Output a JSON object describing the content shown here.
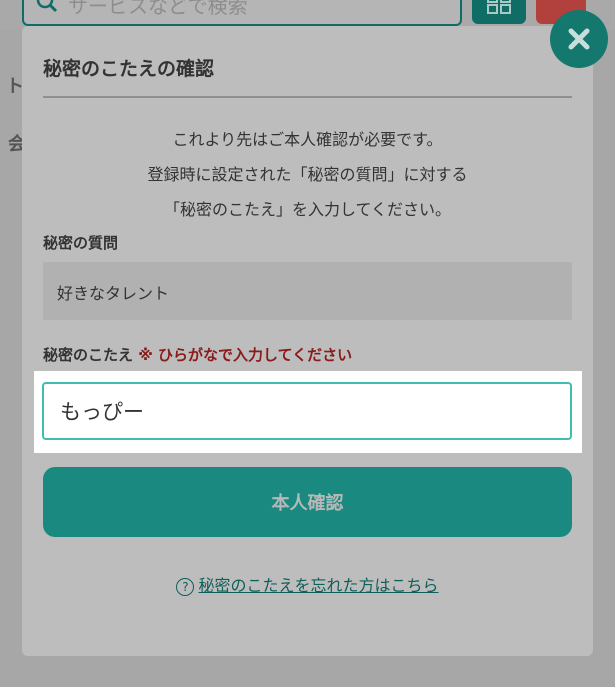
{
  "background": {
    "search_placeholder": "サービスなどで検索",
    "side_text_1": "ト",
    "side_text_2": "会"
  },
  "modal": {
    "title": "秘密のこたえの確認",
    "intro_lines": [
      "これより先はご本人確認が必要です。",
      "登録時に設定された「秘密の質問」に対する",
      "「秘密のこたえ」を入力してください。"
    ],
    "question_label": "秘密の質問",
    "question_value": "好きなタレント",
    "answer_label": "秘密のこたえ",
    "answer_note": "※ ひらがなで入力してください",
    "answer_value": "もっぴー",
    "confirm_label": "本人確認",
    "forgot_icon": "?",
    "forgot_label": "秘密のこたえを忘れた方はこちら"
  },
  "icons": {
    "close": "close-icon",
    "search": "search-icon",
    "grid": "grid-icon",
    "help": "help-circle-icon"
  },
  "colors": {
    "accent": "#1a8a80",
    "input_border": "#40bcb0",
    "note_red": "#8b1a1a",
    "overlay_bg": "#a7a7a7"
  }
}
